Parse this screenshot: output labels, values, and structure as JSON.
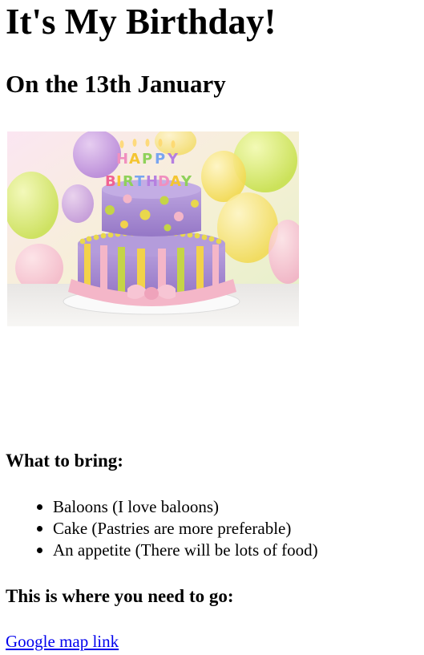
{
  "page": {
    "title": "It's My Birthday!",
    "date": "On the 13th January"
  },
  "picture": {
    "cake_candle_text": [
      "HAPPY",
      "BIRTHDAY"
    ],
    "colors": {
      "cake_purple": "#a98fd0",
      "cake_dots": "#c5d447",
      "ribbon_pink": "#f4b6c8",
      "stripe_yellow": "#f2d24a"
    }
  },
  "bring": {
    "heading": "What to bring:",
    "items": [
      "Baloons (I love baloons)",
      "Cake (Pastries are more preferable)",
      "An appetite (There will be lots of food)"
    ]
  },
  "directions": {
    "heading": "This is where you need to go:",
    "link_text": "Google map link",
    "link_color": "#0000ee"
  }
}
